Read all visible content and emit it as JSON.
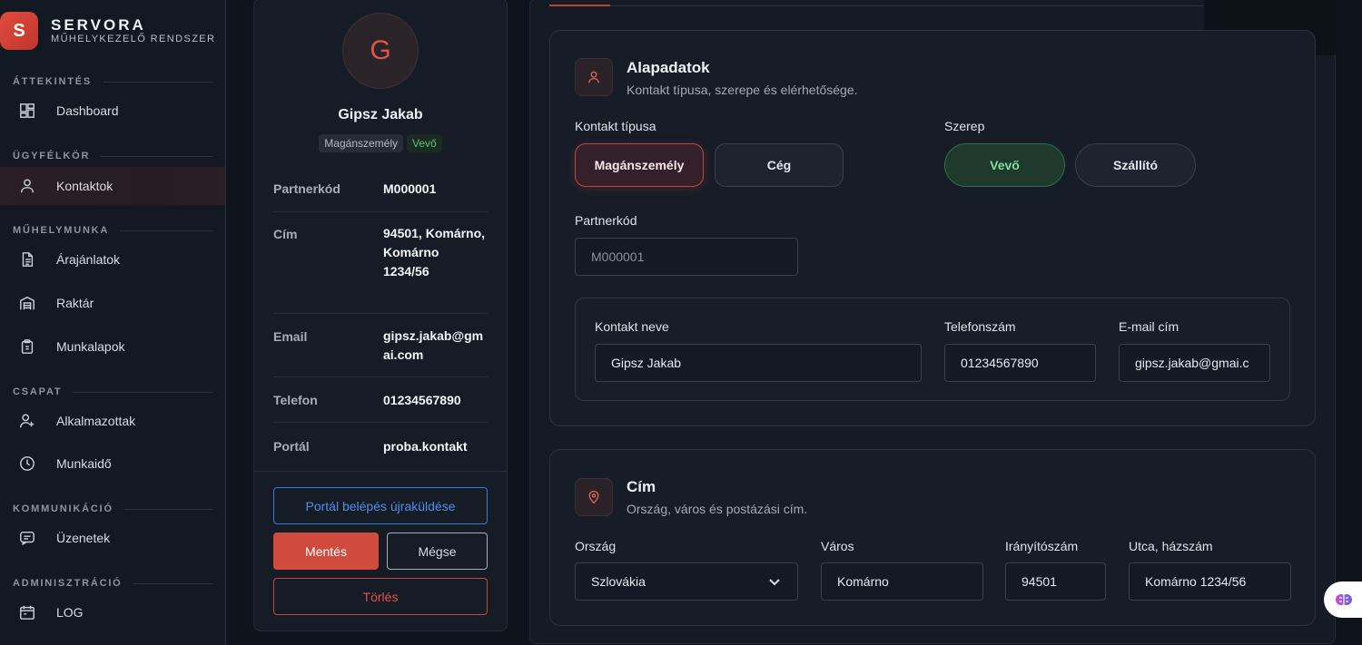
{
  "brand": {
    "logo_letter": "S",
    "name": "SERVORA",
    "subtitle": "MŰHELYKEZELŐ RENDSZER"
  },
  "sidebar": {
    "sections": [
      {
        "title": "ÁTTEKINTÉS"
      },
      {
        "title": "ÜGYFÉLKÖR"
      },
      {
        "title": "MŰHELYMUNKA"
      },
      {
        "title": "CSAPAT"
      },
      {
        "title": "KOMMUNIKÁCIÓ"
      },
      {
        "title": "ADMINISZTRÁCIÓ"
      }
    ],
    "items": [
      {
        "label": "Dashboard",
        "icon": "dashboard-icon"
      },
      {
        "label": "Kontaktok",
        "icon": "user-icon",
        "active": true
      },
      {
        "label": "Árajánlatok",
        "icon": "document-icon"
      },
      {
        "label": "Raktár",
        "icon": "warehouse-icon"
      },
      {
        "label": "Munkalapok",
        "icon": "clipboard-icon"
      },
      {
        "label": "Alkalmazottak",
        "icon": "user-plus-icon"
      },
      {
        "label": "Munkaidő",
        "icon": "clock-icon"
      },
      {
        "label": "Üzenetek",
        "icon": "message-icon"
      },
      {
        "label": "LOG",
        "icon": "log-icon"
      }
    ]
  },
  "profile": {
    "avatar_letter": "G",
    "name": "Gipsz Jakab",
    "badges": [
      "Magánszemély",
      "Vevő"
    ],
    "info": [
      {
        "label": "Partnerkód",
        "value": "M000001"
      },
      {
        "label": "Cím",
        "value": "94501, Komárno, Komárno 1234/56"
      },
      {
        "label": "Email",
        "value": "gipsz.jakab@gmai.com"
      },
      {
        "label": "Telefon",
        "value": "01234567890"
      },
      {
        "label": "Portál",
        "value": "proba.kontakt"
      }
    ],
    "buttons": {
      "portal": "Portál belépés újraküldése",
      "save": "Mentés",
      "cancel": "Mégse",
      "delete": "Törlés"
    }
  },
  "basic": {
    "title": "Alapadatok",
    "subtitle": "Kontakt típusa, szerepe és elérhetősége.",
    "contact_type_label": "Kontakt típusa",
    "contact_types": [
      "Magánszemély",
      "Cég"
    ],
    "role_label": "Szerep",
    "roles": [
      "Vevő",
      "Szállító"
    ],
    "partner_code_label": "Partnerkód",
    "partner_code_placeholder": "M000001",
    "contact_name_label": "Kontakt neve",
    "contact_name_value": "Gipsz Jakab",
    "phone_label": "Telefonszám",
    "phone_value": "01234567890",
    "email_label": "E-mail cím",
    "email_value": "gipsz.jakab@gmai.c"
  },
  "address": {
    "title": "Cím",
    "subtitle": "Ország, város és postázási cím.",
    "country_label": "Ország",
    "country_value": "Szlovákia",
    "city_label": "Város",
    "city_value": "Komárno",
    "zip_label": "Irányítószám",
    "zip_value": "94501",
    "street_label": "Utca, házszám",
    "street_value": "Komárno 1234/56"
  },
  "colors": {
    "accent": "#d04a3e",
    "success": "#59c27a",
    "link": "#4f8fea"
  }
}
